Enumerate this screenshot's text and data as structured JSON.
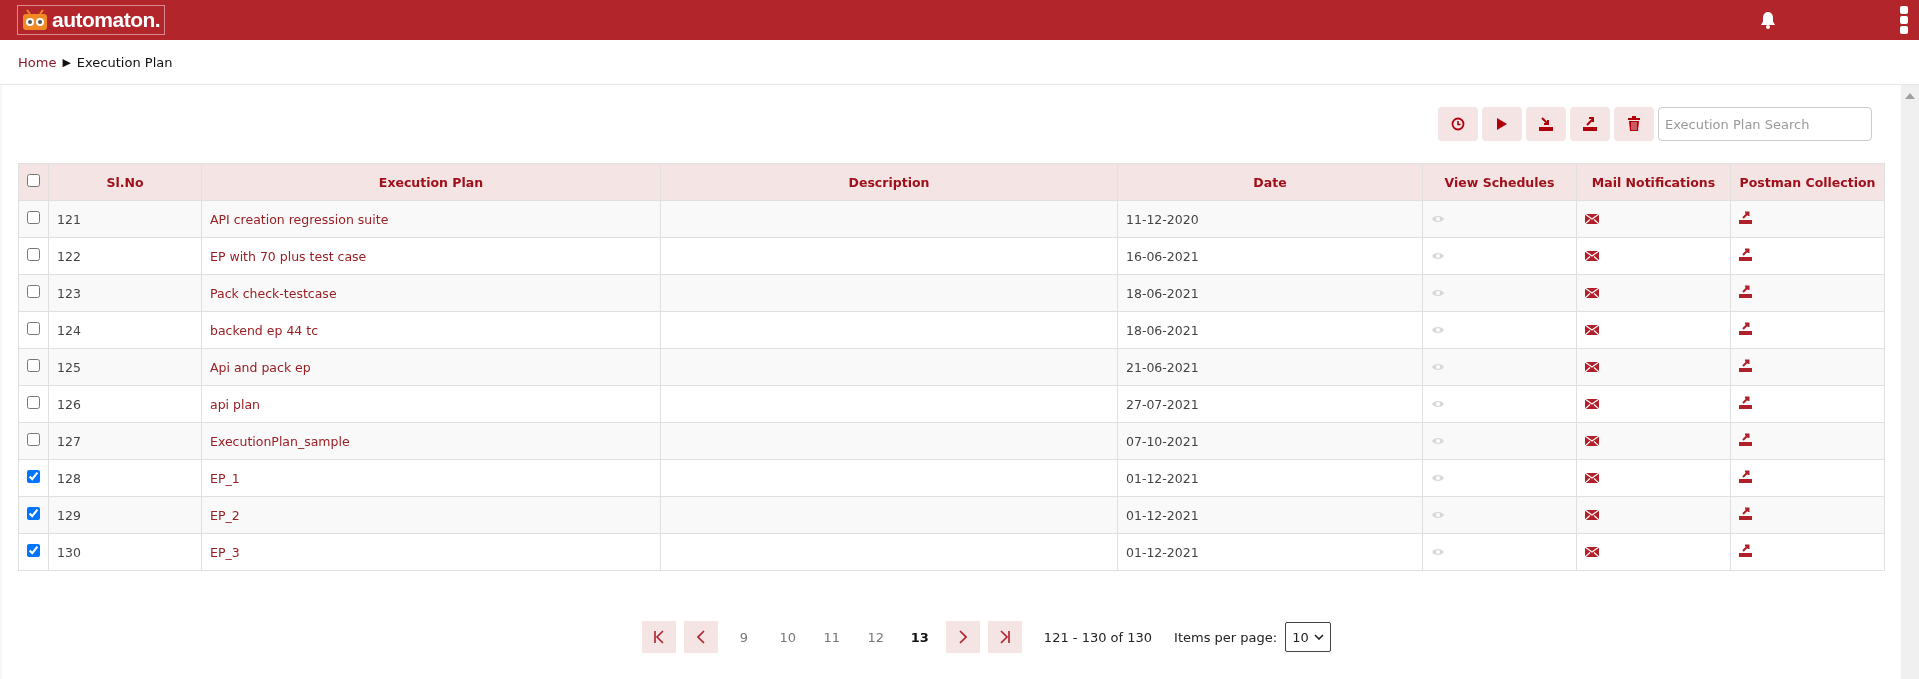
{
  "header": {
    "logo_text": "automaton."
  },
  "breadcrumb": {
    "home": "Home",
    "separator": "▶",
    "current": "Execution Plan"
  },
  "toolbar": {
    "search": {
      "placeholder": "Execution Plan Search"
    }
  },
  "table": {
    "select_all": {
      "checked": false
    },
    "columns": [
      "Sl.No",
      "Execution Plan",
      "Description",
      "Date",
      "View Schedules",
      "Mail Notifications",
      "Postman Collection"
    ],
    "rows": [
      {
        "checked": false,
        "sl_no": "121",
        "plan": "API creation regression suite",
        "description": "",
        "date": "11-12-2020"
      },
      {
        "checked": false,
        "sl_no": "122",
        "plan": "EP with 70 plus test case",
        "description": "",
        "date": "16-06-2021"
      },
      {
        "checked": false,
        "sl_no": "123",
        "plan": "Pack check-testcase",
        "description": "",
        "date": "18-06-2021"
      },
      {
        "checked": false,
        "sl_no": "124",
        "plan": "backend ep 44 tc",
        "description": "",
        "date": "18-06-2021"
      },
      {
        "checked": false,
        "sl_no": "125",
        "plan": "Api and pack ep",
        "description": "",
        "date": "21-06-2021"
      },
      {
        "checked": false,
        "sl_no": "126",
        "plan": "api plan",
        "description": "",
        "date": "27-07-2021"
      },
      {
        "checked": false,
        "sl_no": "127",
        "plan": "ExecutionPlan_sample",
        "description": "",
        "date": "07-10-2021"
      },
      {
        "checked": true,
        "sl_no": "128",
        "plan": "EP_1",
        "description": "",
        "date": "01-12-2021"
      },
      {
        "checked": true,
        "sl_no": "129",
        "plan": "EP_2",
        "description": "",
        "date": "01-12-2021"
      },
      {
        "checked": true,
        "sl_no": "130",
        "plan": "EP_3",
        "description": "",
        "date": "01-12-2021"
      }
    ]
  },
  "pagination": {
    "pages": [
      {
        "label": "9",
        "selected": false
      },
      {
        "label": "10",
        "selected": false
      },
      {
        "label": "11",
        "selected": false
      },
      {
        "label": "12",
        "selected": false
      },
      {
        "label": "13",
        "selected": true
      }
    ],
    "range": "121 - 130 of 130",
    "items_per_page_label": "Items per page:",
    "items_per_page": "10"
  }
}
